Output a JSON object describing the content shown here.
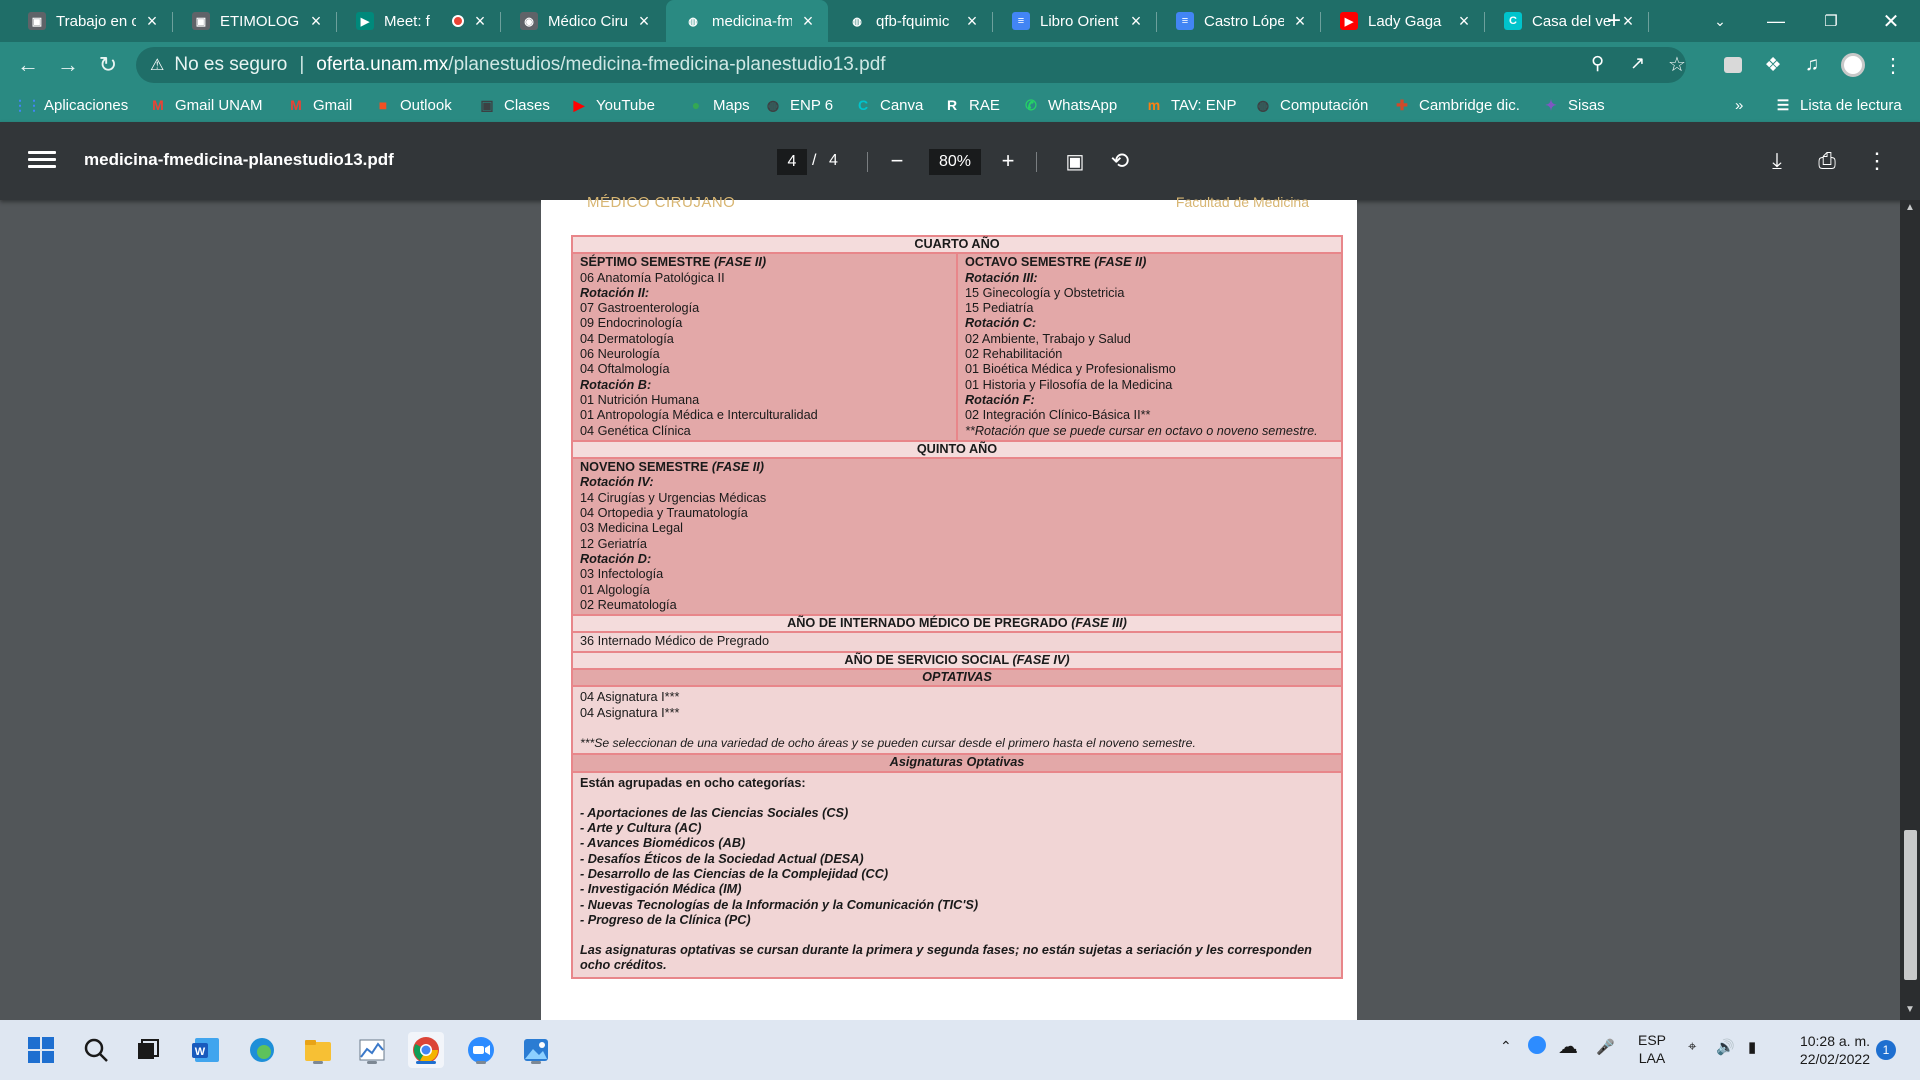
{
  "tabs": [
    {
      "title": "Trabajo en c",
      "icon": "classroom-icon",
      "color": "#5f6368"
    },
    {
      "title": "ETIMOLOGÍ",
      "icon": "classroom-icon",
      "color": "#5f6368"
    },
    {
      "title": "Meet: f",
      "icon": "meet-icon",
      "color": "#00897b",
      "recording": true
    },
    {
      "title": "Médico Ciru",
      "icon": "unam-icon",
      "color": "#5f6368"
    },
    {
      "title": "medicina-fm",
      "icon": "globe-icon",
      "color": "#ffffff",
      "active": true
    },
    {
      "title": "qfb-fquimic",
      "icon": "globe-icon",
      "color": "#ffffff"
    },
    {
      "title": "Libro Orient",
      "icon": "docs-icon",
      "color": "#4285f4"
    },
    {
      "title": "Castro López",
      "icon": "docs-icon",
      "color": "#4285f4"
    },
    {
      "title": "Lady Gaga",
      "icon": "youtube-icon",
      "color": "#ff0000"
    },
    {
      "title": "Casa del ve",
      "icon": "canva-icon",
      "color": "#00c4cc"
    }
  ],
  "new_tab_label": "+",
  "address": {
    "security_label": "No es seguro",
    "host": "oferta.unam.mx",
    "path": "/planestudios/medicina-fmedicina-planestudio13.pdf"
  },
  "bookmarks": [
    {
      "label": "Aplicaciones",
      "icon": "apps-grid-icon",
      "color": "#4285f4"
    },
    {
      "label": "Gmail UNAM",
      "icon": "gmail-icon",
      "color": "#ea4335"
    },
    {
      "label": "Gmail",
      "icon": "gmail-icon",
      "color": "#ea4335"
    },
    {
      "label": "Outlook",
      "icon": "microsoft-icon",
      "color": "#f25022"
    },
    {
      "label": "Clases",
      "icon": "classroom-icon",
      "color": "#3c4043"
    },
    {
      "label": "YouTube",
      "icon": "youtube-icon",
      "color": "#ff0000"
    },
    {
      "label": "Maps",
      "icon": "maps-pin-icon",
      "color": "#34a853"
    },
    {
      "label": "ENP 6",
      "icon": "globe-icon",
      "color": "#3c4043"
    },
    {
      "label": "Canva",
      "icon": "canva-icon",
      "color": "#00c4cc"
    },
    {
      "label": "RAE",
      "icon": "rae-icon",
      "color": "#ffffff"
    },
    {
      "label": "WhatsApp",
      "icon": "whatsapp-icon",
      "color": "#25d366"
    },
    {
      "label": "TAV: ENP",
      "icon": "moodle-icon",
      "color": "#f98012"
    },
    {
      "label": "Computación",
      "icon": "globe-icon",
      "color": "#3c4043"
    },
    {
      "label": "Cambridge dic.",
      "icon": "cambridge-icon",
      "color": "#d04a2a"
    },
    {
      "label": "Sisas",
      "icon": "sisas-icon",
      "color": "#7e57c2"
    }
  ],
  "bookmarks_more": "»",
  "reading_list_label": "Lista de lectura",
  "pdf": {
    "filename": "medicina-fmedicina-planestudio13.pdf",
    "page_current": "4",
    "page_sep": "/",
    "page_total": "4",
    "zoom": "80%"
  },
  "document": {
    "header_left": "MÉDICO CIRUJANO",
    "header_right": "Facultad de Medicina",
    "cuarto_ano": "CUARTO AÑO",
    "septimo": {
      "heading": "SÉPTIMO SEMESTRE",
      "phase": "(FASE II)",
      "lines": [
        {
          "t": "06 Anatomía Patológica II",
          "s": ""
        },
        {
          "t": "Rotación II:",
          "s": "bi"
        },
        {
          "t": "07 Gastroenterología",
          "s": ""
        },
        {
          "t": "09 Endocrinología",
          "s": ""
        },
        {
          "t": "04 Dermatología",
          "s": ""
        },
        {
          "t": "06 Neurología",
          "s": ""
        },
        {
          "t": "04 Oftalmología",
          "s": ""
        },
        {
          "t": "Rotación B:",
          "s": "bi"
        },
        {
          "t": "01 Nutrición Humana",
          "s": ""
        },
        {
          "t": "01 Antropología Médica e Interculturalidad",
          "s": ""
        },
        {
          "t": "04 Genética Clínica",
          "s": ""
        }
      ]
    },
    "octavo": {
      "heading": "OCTAVO SEMESTRE",
      "phase": "(FASE II)",
      "lines": [
        {
          "t": "Rotación III:",
          "s": "bi"
        },
        {
          "t": "15 Ginecología y Obstetricia",
          "s": ""
        },
        {
          "t": "15 Pediatría",
          "s": ""
        },
        {
          "t": "Rotación C:",
          "s": "bi"
        },
        {
          "t": "02 Ambiente, Trabajo y Salud",
          "s": ""
        },
        {
          "t": "02 Rehabilitación",
          "s": ""
        },
        {
          "t": "01 Bioética Médica y Profesionalismo",
          "s": ""
        },
        {
          "t": "01 Historia y Filosofía de la Medicina",
          "s": ""
        },
        {
          "t": "Rotación F:",
          "s": "bi"
        },
        {
          "t": "02 Integración Clínico-Básica II**",
          "s": ""
        },
        {
          "t": "**Rotación que se puede cursar en octavo o noveno semestre.",
          "s": "i"
        }
      ]
    },
    "quinto_ano": "QUINTO AÑO",
    "noveno": {
      "heading": "NOVENO SEMESTRE",
      "phase": "(FASE II)",
      "lines": [
        {
          "t": "Rotación IV:",
          "s": "bi"
        },
        {
          "t": "14 Cirugías y Urgencias Médicas",
          "s": ""
        },
        {
          "t": "04 Ortopedia y Traumatología",
          "s": ""
        },
        {
          "t": "03 Medicina Legal",
          "s": ""
        },
        {
          "t": "12 Geriatría",
          "s": ""
        },
        {
          "t": "Rotación D:",
          "s": "bi"
        },
        {
          "t": "03 Infectología",
          "s": ""
        },
        {
          "t": "01 Algología",
          "s": ""
        },
        {
          "t": "02 Reumatología",
          "s": ""
        }
      ]
    },
    "internado_heading": "AÑO DE INTERNADO MÉDICO DE PREGRADO",
    "internado_phase": "(FASE III)",
    "internado_item": "36 Internado Médico de Pregrado",
    "servicio_heading": "AÑO DE SERVICIO SOCIAL",
    "servicio_phase": "(FASE IV)",
    "optativas_heading": "OPTATIVAS",
    "optativas_lines": [
      "04 Asignatura I***",
      "04 Asignatura I***"
    ],
    "optativas_note": "***Se seleccionan de una variedad de ocho áreas y se pueden cursar desde el primero hasta el noveno semestre.",
    "asignaturas_heading": "Asignaturas Optativas",
    "asignaturas_intro": "Están agrupadas en ocho categorías:",
    "categorias": [
      "- Aportaciones de las Ciencias Sociales (CS)",
      "- Arte y Cultura (AC)",
      "- Avances Biomédicos (AB)",
      "- Desafíos Éticos de la Sociedad Actual (DESA)",
      "- Desarrollo de las Ciencias de la Complejidad (CC)",
      "- Investigación Médica (IM)",
      "- Nuevas Tecnologías de la Información y la Comunicación (TIC'S)",
      "- Progreso de la Clínica (PC)"
    ],
    "asignaturas_footer": "Las asignaturas optativas se cursan durante la primera y segunda fases; no están sujetas a seriación y les corresponden ocho créditos."
  },
  "taskbar": {
    "lang_top": "ESP",
    "lang_bottom": "LAA",
    "time": "10:28 a. m.",
    "date": "22/02/2022",
    "notifications": "1"
  }
}
